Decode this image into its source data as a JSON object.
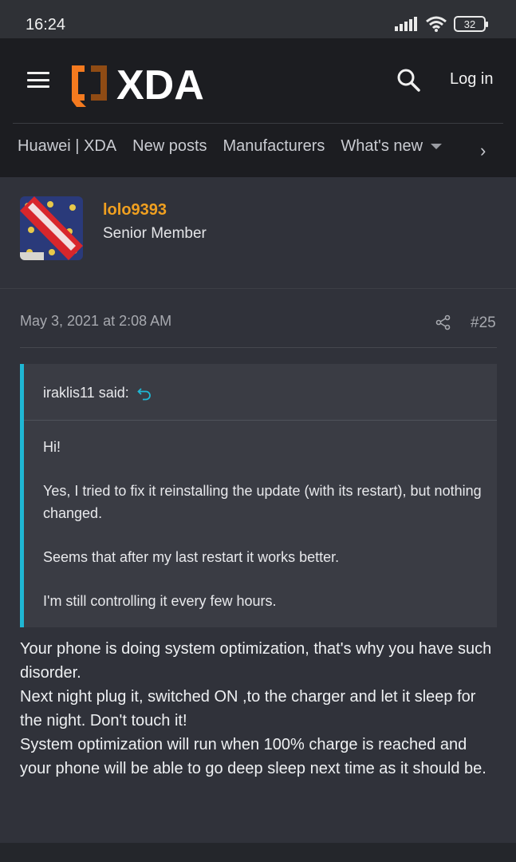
{
  "status": {
    "time": "16:24",
    "battery": "32"
  },
  "header": {
    "logo_text": "XDA",
    "login_label": "Log in",
    "nav": [
      "Huawei | XDA",
      "New posts",
      "Manufacturers",
      "What's new"
    ]
  },
  "user": {
    "name": "lolo9393",
    "title": "Senior Member"
  },
  "post": {
    "date": "May 3, 2021 at 2:08 AM",
    "number": "#25",
    "quote": {
      "author": "iraklis11 said:",
      "lines": [
        "Hi!",
        "Yes, I tried to fix it reinstalling the update (with its restart), but nothing changed.",
        "Seems that after my last restart it works better.",
        "I'm still controlling it every few hours."
      ]
    },
    "reply_lines": [
      "Your phone is doing system optimization, that's why you have such disorder.",
      "Next night plug it, switched ON ,to the charger and let it sleep for the night. Don't touch it!",
      "System optimization will run when 100% charge is reached and your phone will be able to go deep sleep next time as it should be."
    ]
  },
  "colors": {
    "accent_orange": "#f0a020",
    "quote_bar": "#1fb7d4",
    "logo_orange": "#f47a1f"
  }
}
